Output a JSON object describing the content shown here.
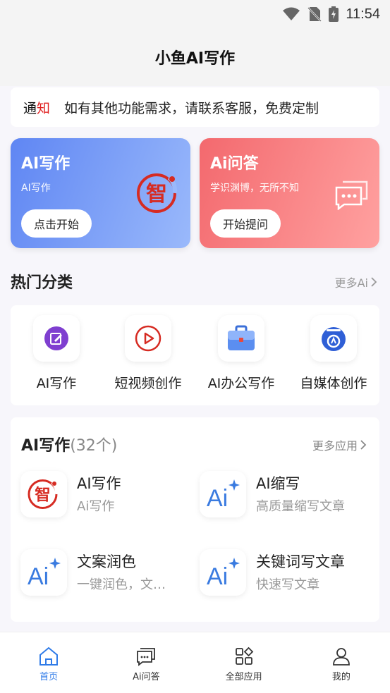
{
  "status_bar": {
    "time": "11:54"
  },
  "header": {
    "title": "小鱼AI写作"
  },
  "notice": {
    "tag_part1": "通",
    "tag_part2": "知",
    "message": "如有其他功能需求，请联系客服，免费定制"
  },
  "cards": [
    {
      "title": "AI写作",
      "subtitle": "AI写作",
      "button": "点击开始",
      "icon": "zhi-logo-icon",
      "gradient": [
        "#5f86f3",
        "#9ab9fb"
      ]
    },
    {
      "title": "Ai问答",
      "subtitle": "学识渊博，无所不知",
      "button": "开始提问",
      "icon": "chat-bubbles-icon",
      "gradient": [
        "#f3696e",
        "#ffa1a0"
      ]
    }
  ],
  "hot_categories": {
    "title": "热门分类",
    "more": "更多Ai",
    "items": [
      {
        "label": "AI写作",
        "icon": "edit-note-icon"
      },
      {
        "label": "短视频创作",
        "icon": "play-icon"
      },
      {
        "label": "AI办公写作",
        "icon": "briefcase-icon"
      },
      {
        "label": "自媒体创作",
        "icon": "media-badge-icon"
      }
    ]
  },
  "apps": {
    "title": "AI写作",
    "count": "(32个)",
    "more": "更多应用",
    "items": [
      {
        "name": "AI写作",
        "desc": "Ai写作",
        "icon": "zhi-logo-icon"
      },
      {
        "name": "AI缩写",
        "desc": "高质量缩写文章",
        "icon": "ai-sparkle-icon"
      },
      {
        "name": "文案润色",
        "desc": "一键润色，文…",
        "icon": "ai-sparkle-icon"
      },
      {
        "name": "关键词写文章",
        "desc": "快速写文章",
        "icon": "ai-sparkle-icon"
      }
    ]
  },
  "tabbar": {
    "items": [
      {
        "label": "首页",
        "icon": "home-icon",
        "active": true
      },
      {
        "label": "Ai问答",
        "icon": "chat-icon",
        "active": false
      },
      {
        "label": "全部应用",
        "icon": "grid-apps-icon",
        "active": false
      },
      {
        "label": "我的",
        "icon": "user-icon",
        "active": false
      }
    ]
  },
  "colors": {
    "accent": "#2f7be8",
    "notice_red": "#e02020",
    "brand_red": "#d62b22"
  }
}
